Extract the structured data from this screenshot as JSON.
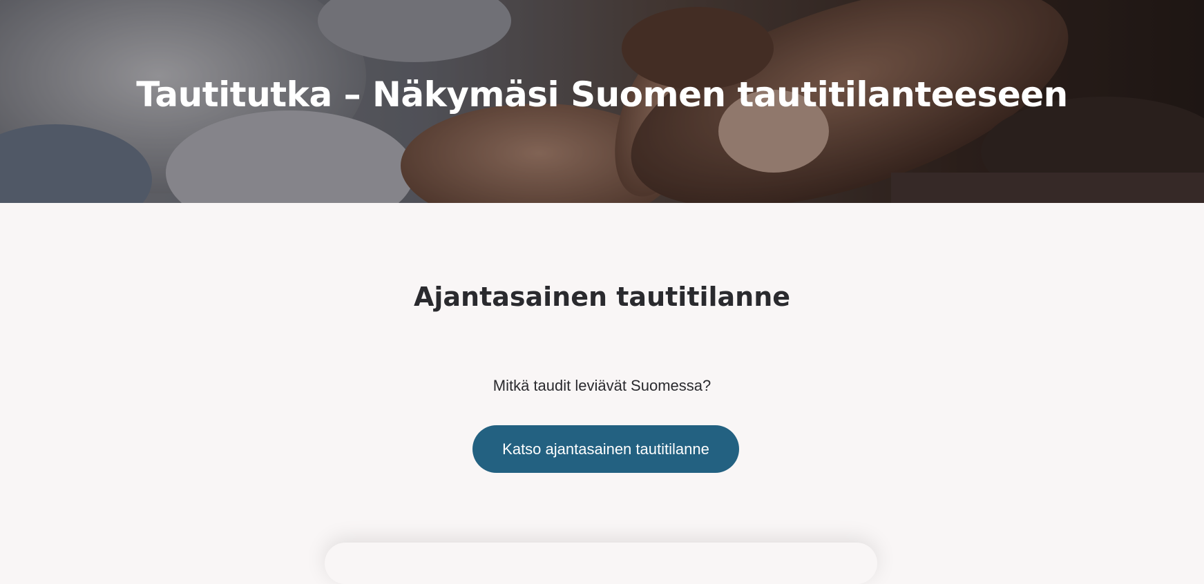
{
  "hero": {
    "title": "Tautitutka – Näkymäsi Suomen tautitilanteeseen"
  },
  "section": {
    "title": "Ajantasainen tautitilanne",
    "lead": "Mitkä taudit leviävät Suomessa?",
    "cta_label": "Katso ajantasainen tautitilanne"
  },
  "colors": {
    "cta_background": "#236181",
    "page_background": "#f9f6f6",
    "heading_text": "#2a2a2e"
  }
}
